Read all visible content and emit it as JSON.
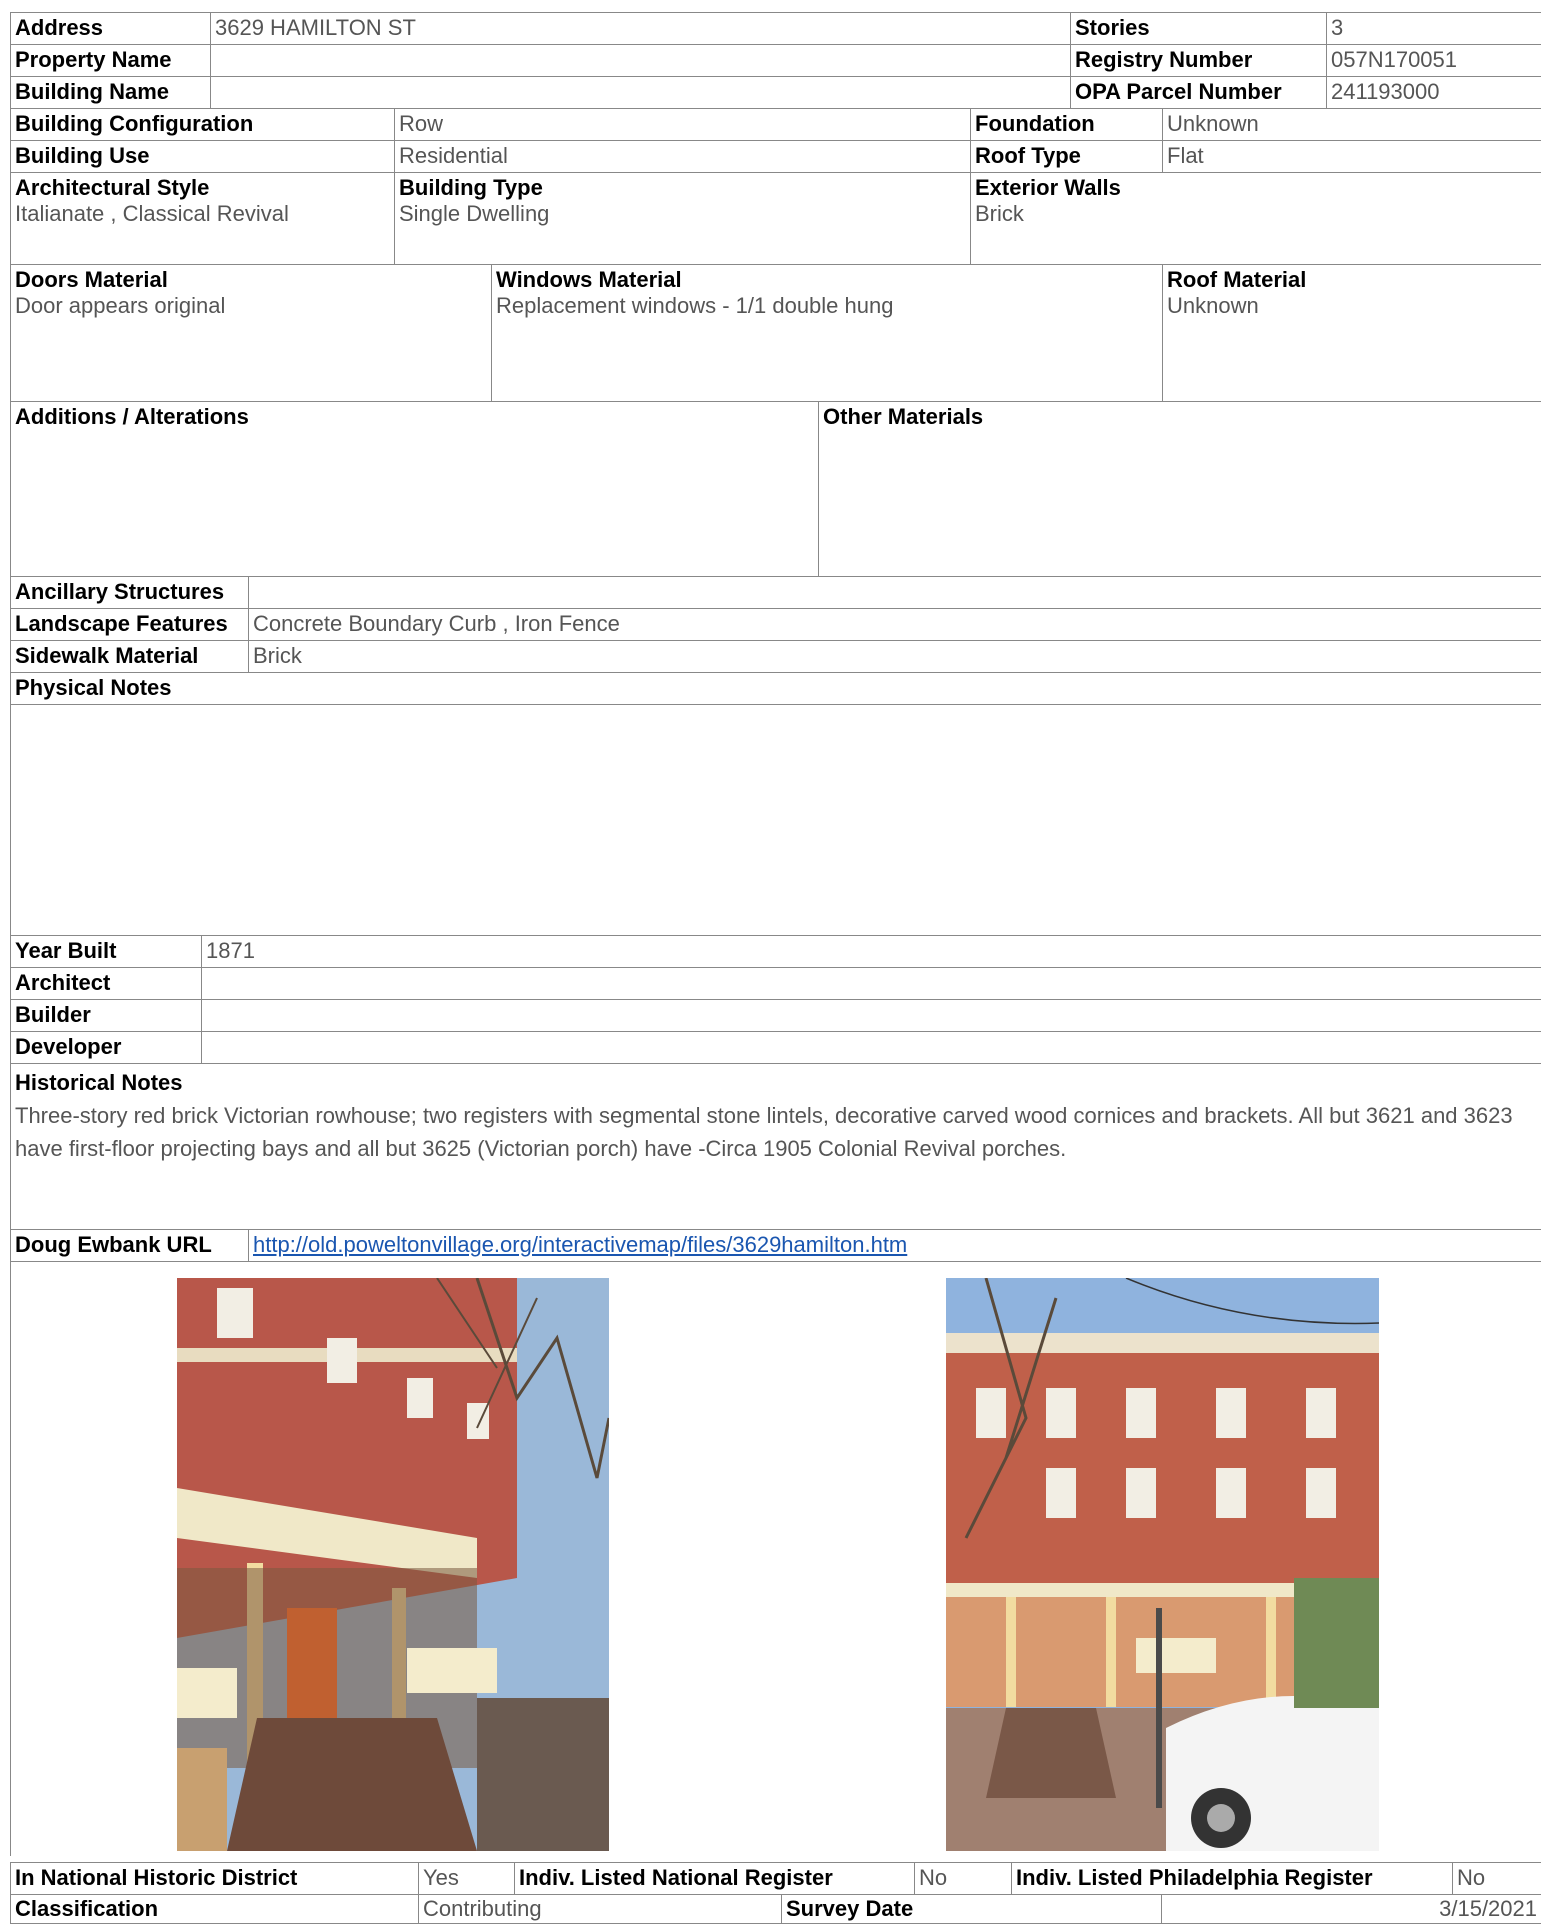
{
  "row1": {
    "address_label": "Address",
    "address_value": "3629 HAMILTON ST",
    "stories_label": "Stories",
    "stories_value": "3"
  },
  "row2": {
    "property_label": "Property Name",
    "property_value": "",
    "registry_label": "Registry Number",
    "registry_value": "057N170051"
  },
  "row3": {
    "building_label": "Building Name",
    "building_value": "",
    "opa_label": "OPA Parcel Number",
    "opa_value": "241193000"
  },
  "row4": {
    "config_label": "Building Configuration",
    "config_value": "Row",
    "foundation_label": "Foundation",
    "foundation_value": "Unknown"
  },
  "row5": {
    "use_label": "Building Use",
    "use_value": "Residential",
    "rooftype_label": "Roof Type",
    "rooftype_value": "Flat"
  },
  "row6": {
    "style_label": "Architectural Style",
    "style_value": "Italianate , Classical Revival",
    "type_label": "Building Type",
    "type_value": "Single Dwelling",
    "walls_label": "Exterior Walls",
    "walls_value": "Brick"
  },
  "materials": {
    "doors_label": "Doors Material",
    "doors_value": "Door appears original",
    "windows_label": "Windows Material",
    "windows_value": "Replacement windows - 1/1 double hung",
    "roofmat_label": "Roof Material",
    "roofmat_value": "Unknown"
  },
  "alterations": {
    "additions_label": "Additions / Alterations",
    "additions_value": "",
    "other_label": "Other Materials",
    "other_value": ""
  },
  "site": {
    "ancillary_label": "Ancillary Structures",
    "ancillary_value": "",
    "landscape_label": "Landscape Features",
    "landscape_value": "Concrete Boundary Curb , Iron Fence",
    "sidewalk_label": "Sidewalk Material",
    "sidewalk_value": "Brick",
    "physical_label": "Physical Notes",
    "physical_value": ""
  },
  "history": {
    "year_label": "Year Built",
    "year_value": "1871",
    "architect_label": "Architect",
    "architect_value": "",
    "builder_label": "Builder",
    "builder_value": "",
    "developer_label": "Developer",
    "developer_value": "",
    "notes_label": "Historical Notes",
    "notes_value": "Three-story red brick Victorian rowhouse; two registers with segmental stone lintels, decorative carved wood cornices and brackets. All but 3621 and 3623 have first-floor projecting bays and all but 3625 (Victorian porch) have -Circa 1905 Colonial Revival porches."
  },
  "url": {
    "label": "Doug Ewbank URL",
    "value": "http://old.poweltonvillage.org/interactivemap/files/3629hamilton.htm"
  },
  "footer": {
    "district_label": "In National Historic District",
    "district_value": "Yes",
    "national_label": "Indiv. Listed National Register",
    "national_value": "No",
    "phila_label": "Indiv. Listed Philadelphia Register",
    "phila_value": "No",
    "class_label": "Classification",
    "class_value": "Contributing",
    "survey_label": "Survey Date",
    "survey_value": "3/15/2021"
  }
}
